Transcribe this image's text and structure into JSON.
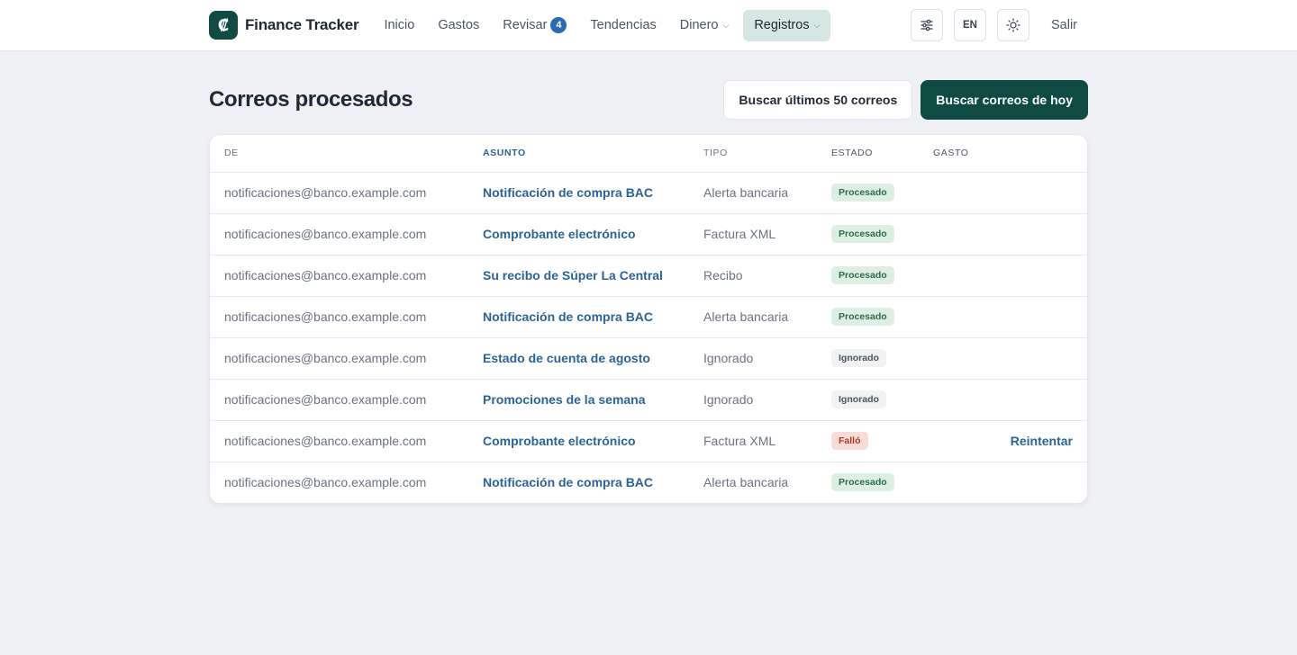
{
  "brand": {
    "logo_glyph": "₡",
    "name": "Finance Tracker"
  },
  "nav": {
    "items": [
      {
        "label": "Inicio"
      },
      {
        "label": "Gastos"
      },
      {
        "label": "Revisar",
        "badge": "4"
      },
      {
        "label": "Tendencias"
      },
      {
        "label": "Dinero",
        "has_dropdown": true
      },
      {
        "label": "Registros",
        "has_dropdown": true,
        "active": true
      }
    ]
  },
  "header": {
    "settings_icon": "sliders-icon",
    "language": "EN",
    "theme_icon": "sun-icon",
    "logout": "Salir"
  },
  "page": {
    "title": "Correos procesados",
    "fetch_recent_label": "Buscar últimos 50 correos",
    "fetch_today_label": "Buscar correos de hoy"
  },
  "table": {
    "columns": [
      "DE",
      "ASUNTO",
      "TIPO",
      "ESTADO",
      "GASTO"
    ],
    "rows": [
      {
        "from": "notificaciones@banco.example.com",
        "subject": "Notificación de compra BAC",
        "type": "Alerta bancaria",
        "status": "Procesado",
        "status_kind": "ok",
        "action": ""
      },
      {
        "from": "notificaciones@banco.example.com",
        "subject": "Comprobante electrónico",
        "type": "Factura XML",
        "status": "Procesado",
        "status_kind": "ok",
        "action": ""
      },
      {
        "from": "notificaciones@banco.example.com",
        "subject": "Su recibo de Súper La Central",
        "type": "Recibo",
        "status": "Procesado",
        "status_kind": "ok",
        "action": ""
      },
      {
        "from": "notificaciones@banco.example.com",
        "subject": "Notificación de compra BAC",
        "type": "Alerta bancaria",
        "status": "Procesado",
        "status_kind": "ok",
        "action": ""
      },
      {
        "from": "notificaciones@banco.example.com",
        "subject": "Estado de cuenta de agosto",
        "type": "Ignorado",
        "status": "Ignorado",
        "status_kind": "ign",
        "action": ""
      },
      {
        "from": "notificaciones@banco.example.com",
        "subject": "Promociones de la semana",
        "type": "Ignorado",
        "status": "Ignorado",
        "status_kind": "ign",
        "action": ""
      },
      {
        "from": "notificaciones@banco.example.com",
        "subject": "Comprobante electrónico",
        "type": "Factura XML",
        "status": "Falló",
        "status_kind": "fail",
        "action": "Reintentar"
      },
      {
        "from": "notificaciones@banco.example.com",
        "subject": "Notificación de compra BAC",
        "type": "Alerta bancaria",
        "status": "Procesado",
        "status_kind": "ok",
        "action": ""
      }
    ]
  },
  "colors": {
    "brand": "#0f4a43",
    "active_nav_bg": "#d6e7e3",
    "link": "#2c6396",
    "status_ok_bg": "#dcefe2",
    "status_fail_bg": "#f8dcd8"
  }
}
